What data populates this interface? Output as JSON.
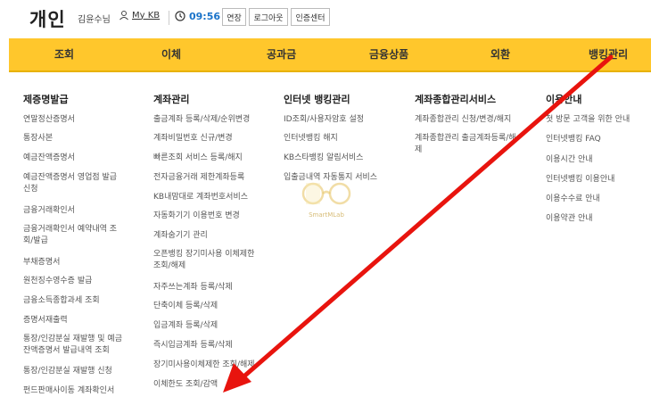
{
  "header": {
    "title": "개인",
    "user": "김윤수님",
    "mykb": "My KB",
    "timer": "09:56",
    "extend": "연장",
    "logout": "로그아웃",
    "cert": "인증센터"
  },
  "nav": [
    "조회",
    "이체",
    "공과금",
    "금융상품",
    "외환",
    "뱅킹관리"
  ],
  "columns": {
    "col1": {
      "title": "제증명발급",
      "items": [
        "연말정산증명서",
        "통장사본",
        "예금잔액증명서",
        "예금잔액증명서 영업점 발급\n신청",
        "금융거래확인서",
        "금융거래확인서 예약내역 조\n회/발급",
        "부채증명서",
        "원천징수영수증 발급",
        "금융소득종합과세 조회",
        "증명서재출력",
        "통장/인감분실 재발행 및 예금\n잔액증명서 발급내역 조회",
        "통장/인감분실 재발행 신청",
        "펀드판매사이동 계좌확인서"
      ]
    },
    "col2": {
      "title": "계좌관리",
      "items": [
        "출금계좌 등록/삭제/순위변경",
        "계좌비밀번호 신규/변경",
        "빠른조회 서비스 등록/해지",
        "전자금융거래 제한계좌등록",
        "KB내맘대로 계좌번호서비스",
        "자동화기기 이용번호 변경",
        "계좌숨기기 관리",
        "오픈뱅킹 장기미사용 이체제한\n조회/해제",
        "자주쓰는계좌 등록/삭제",
        "단축이체 등록/삭제",
        "입금계좌 등록/삭제",
        "즉시입금계좌 등록/삭제",
        "장기미사용이체제한 조회/해제",
        "이체한도 조회/감액"
      ]
    },
    "col3": {
      "title": "인터넷 뱅킹관리",
      "items": [
        "ID조회/사용자암호 설정",
        "인터넷뱅킹 해지",
        "KB스타뱅킹 알림서비스",
        "입출금내역 자동통지 서비스"
      ]
    },
    "col4": {
      "title": "계좌종합관리서비스",
      "items": [
        "계좌종합관리 신청/변경/해지",
        "계좌종합관리 출금계좌등록/해\n제"
      ]
    },
    "col5": {
      "title": "이용안내",
      "items": [
        "첫 방문 고객을 위한 안내",
        "인터넷뱅킹 FAQ",
        "이용시간 안내",
        "인터넷뱅킹 이용안내",
        "이용수수료 안내",
        "이용약관 안내"
      ]
    }
  },
  "watermark": "SmartMLab",
  "colors": {
    "nav_bg": "#ffc72c",
    "arrow": "#e8140e",
    "timer": "#1a73c9"
  }
}
